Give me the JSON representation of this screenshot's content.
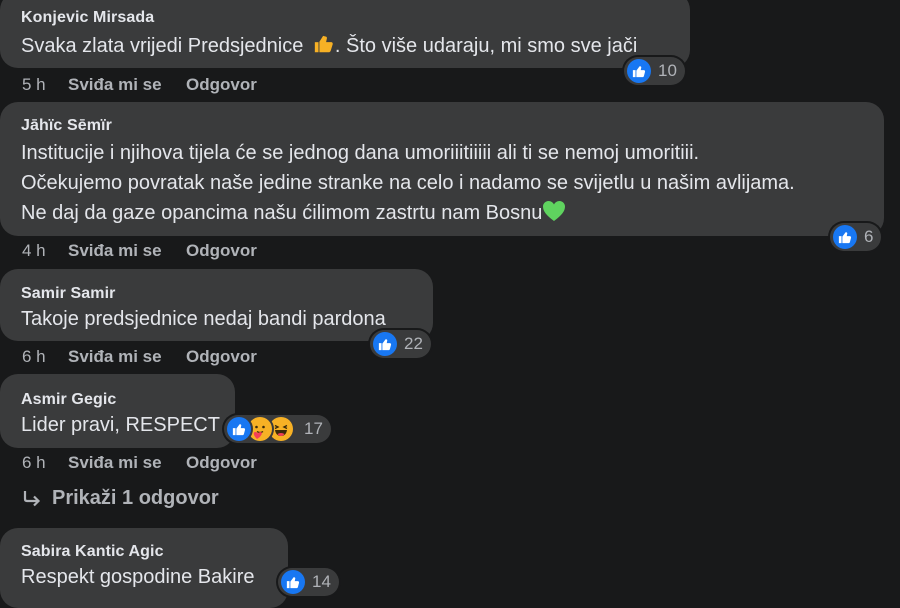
{
  "comments": [
    {
      "author": "Konjevic Mirsada",
      "text_before": "Svaka zlata vrijedi Predsjednice ",
      "text_after": ". Što više udaraju, mi smo sve jači",
      "time": "5 h",
      "like_label": "Sviđa mi se",
      "reply_label": "Odgovor",
      "reactions": [
        "like"
      ],
      "reaction_count": "10"
    },
    {
      "author": "Jāhïc Sēmïr",
      "text": "Institucije i njihova tijela će se jednog dana umoriiitiiiii ali ti se nemoj umoritiii.\nOčekujemo povratak naše jedine stranke na celo i nadamo se svijetlu u našim avlijama.\nNe daj da gaze opancima našu ćilimom zastrtu nam Bosnu",
      "time": "4 h",
      "like_label": "Sviđa mi se",
      "reply_label": "Odgovor",
      "reactions": [
        "like"
      ],
      "reaction_count": "6"
    },
    {
      "author": "Samir Samir",
      "text": "Takoje predsjednice nedaj bandi pardona",
      "time": "6 h",
      "like_label": "Sviđa mi se",
      "reply_label": "Odgovor",
      "reactions": [
        "like"
      ],
      "reaction_count": "22"
    },
    {
      "author": "Asmir Gegic",
      "text": "Lider pravi, RESPECT",
      "time": "6 h",
      "like_label": "Sviđa mi se",
      "reply_label": "Odgovor",
      "reactions": [
        "like",
        "care",
        "haha"
      ],
      "reaction_count": "17"
    },
    {
      "author": "Sabira Kantic Agic",
      "text": "Respekt gospodine Bakire",
      "reactions": [
        "like"
      ],
      "reaction_count": "14"
    }
  ],
  "view_replies_label": "Prikaži 1 odgovor",
  "colors": {
    "background": "#18191a",
    "bubble": "#3a3b3c",
    "text": "#e4e6eb",
    "secondary_text": "#b0b3b8",
    "like_blue": "#1877f2",
    "heart_green": "#5fd35f",
    "thumb_yellow": "#f7b125"
  },
  "icons": {
    "like": "thumbs-up-icon",
    "care": "care-emoji-icon",
    "haha": "haha-emoji-icon",
    "thumb_emoji": "thumbs-up-emoji",
    "green_heart": "green-heart-emoji",
    "reply_arrow": "reply-arrow-icon"
  }
}
